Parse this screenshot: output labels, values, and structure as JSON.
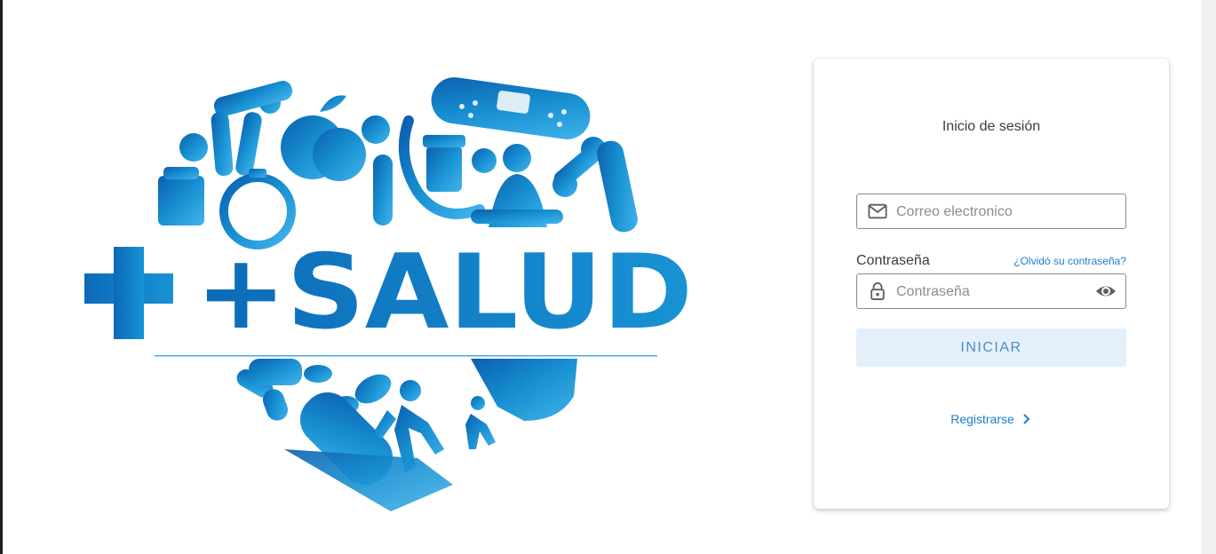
{
  "logo": {
    "brand_text": "+SALUD",
    "colors": {
      "primary": "#1890d2",
      "dark": "#0b5fae",
      "light": "#42b4ea"
    }
  },
  "login": {
    "title": "Inicio de sesión",
    "email": {
      "placeholder": "Correo electronico",
      "icon": "mail-icon"
    },
    "password": {
      "label": "Contraseña",
      "placeholder": "Contraseña",
      "icon": "lock-icon",
      "toggle_icon": "eye-icon"
    },
    "forgot_link": "¿Olvidó su contraseña?",
    "submit_label": "INICIAR",
    "register_link": "Registrarse",
    "accent_color": "#1e7fd0"
  }
}
